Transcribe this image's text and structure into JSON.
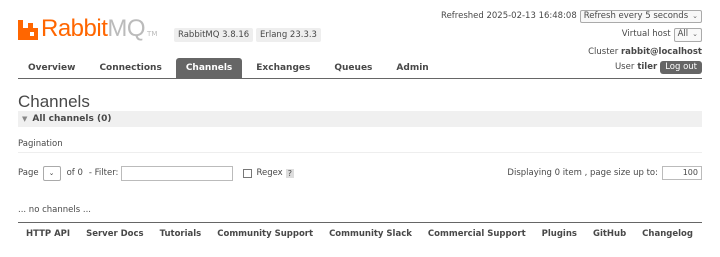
{
  "logo": {
    "text_a": "Rabbit",
    "text_b": "MQ",
    "tm": "TM"
  },
  "versions": {
    "rabbitmq": "RabbitMQ 3.8.16",
    "erlang": "Erlang 23.3.3"
  },
  "header": {
    "refreshed": "Refreshed 2025-02-13 16:48:08",
    "refresh_option": "Refresh every 5 seconds",
    "vhost_label": "Virtual host",
    "vhost_value": "All",
    "cluster_label": "Cluster",
    "cluster_value": "rabbit@localhost",
    "user_label": "User",
    "user_value": "tiler",
    "logout": "Log out"
  },
  "tabs": [
    {
      "label": "Overview"
    },
    {
      "label": "Connections"
    },
    {
      "label": "Channels",
      "active": true
    },
    {
      "label": "Exchanges"
    },
    {
      "label": "Queues"
    },
    {
      "label": "Admin"
    }
  ],
  "main": {
    "title": "Channels",
    "section": "All channels (0)",
    "pagination_label": "Pagination",
    "page_label": "Page",
    "of_label": "of 0",
    "filter_label": "- Filter:",
    "filter_value": "",
    "regex_label": "Regex",
    "help": "?",
    "display_info": "Displaying 0 item , page size up to:",
    "page_size": "100",
    "no_channels": "... no channels ..."
  },
  "footer": [
    "HTTP API",
    "Server Docs",
    "Tutorials",
    "Community Support",
    "Community Slack",
    "Commercial Support",
    "Plugins",
    "GitHub",
    "Changelog"
  ]
}
